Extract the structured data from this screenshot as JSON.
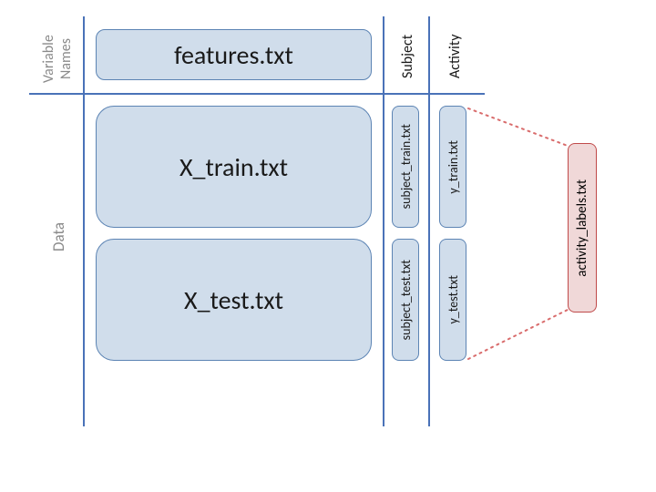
{
  "rows": {
    "header": "Variable Names",
    "data": "Data"
  },
  "cols": {
    "subject": "Subject",
    "activity": "Activity"
  },
  "files": {
    "features": "features.txt",
    "x_train": "X_train.txt",
    "x_test": "X_test.txt",
    "subject_train": "subject_train.txt",
    "subject_test": "subject_test.txt",
    "y_train": "y_train.txt",
    "y_test": "y_test.txt",
    "activity_labels": "activity_labels.txt"
  },
  "colors": {
    "box_fill": "#d0ddeb",
    "box_stroke": "#5c84b4",
    "grid": "#4a72b8",
    "muted": "#8a8a8a",
    "activity_fill": "#f0d8d8",
    "activity_stroke": "#c04a4a",
    "dotline": "#d96c6c"
  }
}
